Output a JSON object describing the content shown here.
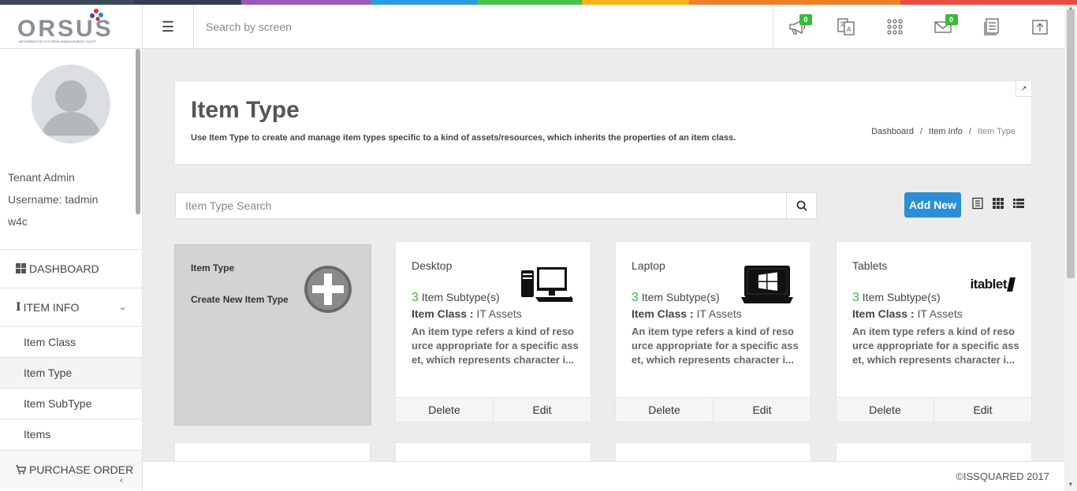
{
  "colors": {
    "rainbow": [
      "#3a4a5a",
      "#9b59b6",
      "#2d9be0",
      "#4cc24c",
      "#f3b21b",
      "#f07d28",
      "#e74c3c"
    ],
    "accent": "#2a8fd4",
    "count_green": "#3cb93c"
  },
  "header": {
    "logo_text": "ORSUS",
    "logo_subtext": "INFORMATION SYSTEMS MANAGEMENT SUITE",
    "menu_icon": "hamburger-icon",
    "search_placeholder": "Search by screen",
    "icons": [
      {
        "name": "megaphone-icon",
        "badge": "0"
      },
      {
        "name": "translate-icon",
        "badge": ""
      },
      {
        "name": "apps-grid-icon",
        "badge": ""
      },
      {
        "name": "mail-icon",
        "badge": "0"
      },
      {
        "name": "document-icon",
        "badge": ""
      },
      {
        "name": "upload-icon",
        "badge": ""
      }
    ]
  },
  "user": {
    "role": "Tenant Admin",
    "username": "Username: tadmin",
    "tenant": "w4c"
  },
  "sidebar": {
    "dashboard": "DASHBOARD",
    "item_info": "ITEM INFO",
    "sub_items": [
      "Item Class",
      "Item Type",
      "Item SubType",
      "Items"
    ],
    "active_sub_item": "Item Type",
    "purchase_order": "PURCHASE ORDER",
    "collapse_icon": "chevron-left-icon"
  },
  "page": {
    "title": "Item Type",
    "description": "Use Item Type to create and manage item types specific to a kind of assets/resources, which inherits the properties of an item class.",
    "breadcrumb": [
      "Dashboard",
      "Item Info",
      "Item Type"
    ]
  },
  "toolbar": {
    "search_placeholder": "Item Type Search",
    "add_new_label": "Add New",
    "view_icons": [
      "list-view-icon",
      "grid-view-icon",
      "detail-list-icon"
    ]
  },
  "create_card": {
    "title": "Item Type",
    "subtitle": "Create New Item Type"
  },
  "cards": [
    {
      "name": "Desktop",
      "subtype_count": "3",
      "subtype_label": "Item Subtype(s)",
      "class_label": "Item Class :",
      "class_value": "IT Assets",
      "description": "An item type refers a kind of resource appropriate for a specific asset, which represents character i...",
      "image": "desktop-computer-icon",
      "delete_label": "Delete",
      "edit_label": "Edit"
    },
    {
      "name": "Laptop",
      "subtype_count": "3",
      "subtype_label": "Item Subtype(s)",
      "class_label": "Item Class :",
      "class_value": "IT Assets",
      "description": "An item type refers a kind of resource appropriate for a specific asset, which represents character i...",
      "image": "laptop-windows-icon",
      "delete_label": "Delete",
      "edit_label": "Edit"
    },
    {
      "name": "Tablets",
      "subtype_count": "3",
      "subtype_label": "Item Subtype(s)",
      "class_label": "Item Class :",
      "class_value": "IT Assets",
      "description": "An item type refers a kind of resource appropriate for a specific asset, which represents character i...",
      "image_text": "itablet",
      "delete_label": "Delete",
      "edit_label": "Edit"
    }
  ],
  "footer": {
    "copyright": "©ISSQUARED 2017"
  }
}
